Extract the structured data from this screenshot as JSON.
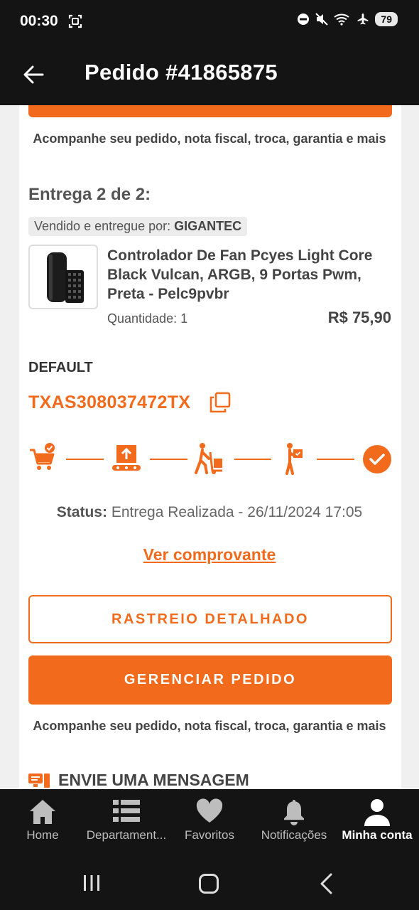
{
  "status_bar": {
    "time": "00:30",
    "battery": "79",
    "icons": [
      "screenshot-icon",
      "dnd-icon",
      "mute-icon",
      "wifi-icon",
      "airplane-icon"
    ]
  },
  "app_bar": {
    "title": "Pedido #41865875",
    "back_icon": "arrow-left-icon"
  },
  "previous_delivery": {
    "helper_text": "Acompanhe seu pedido, nota fiscal, troca, garantia e mais"
  },
  "delivery": {
    "title": "Entrega 2 de 2:",
    "seller_prefix": "Vendido e entregue por: ",
    "seller_name": "GIGANTEC",
    "product": {
      "name": "Controlador De Fan Pcyes Light Core Black Vulcan, ARGB, 9 Portas Pwm, Preta - Pelc9pvbr",
      "quantity": "Quantidade: 1",
      "price": "R$ 75,90"
    },
    "carrier": "DEFAULT",
    "tracking_code": "TXAS308037472TX",
    "steps": [
      "cart-check-icon",
      "package-conveyor-icon",
      "person-cart-icon",
      "person-box-icon",
      "check-circle-icon"
    ],
    "status_label": "Status:",
    "status_value": " Entrega Realizada - 26/11/2024 17:05",
    "receipt_link": "Ver comprovante",
    "track_button": "RASTREIO DETALHADO",
    "manage_button": "GERENCIAR PEDIDO",
    "helper_text": "Acompanhe seu pedido, nota fiscal, troca, garantia e mais",
    "message_label": "ENVIE UMA MENSAGEM"
  },
  "bottom_nav": {
    "items": [
      {
        "label": "Home",
        "icon": "home-icon"
      },
      {
        "label": "Departament...",
        "icon": "list-icon"
      },
      {
        "label": "Favoritos",
        "icon": "heart-icon"
      },
      {
        "label": "Notificações",
        "icon": "bell-icon"
      },
      {
        "label": "Minha conta",
        "icon": "user-icon"
      }
    ],
    "active_index": 4
  },
  "colors": {
    "accent": "#f26b1d",
    "bar_background": "#141414",
    "page_background": "#f0f0f0"
  }
}
